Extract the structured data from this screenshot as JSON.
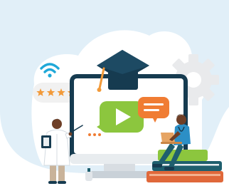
{
  "illustration": {
    "rating": {
      "value": 5,
      "max": 5
    },
    "colors": {
      "background": "#ffffff",
      "backdrop": "#e1eff8",
      "gear": "#e9eaec",
      "wifi": "#1fa8d8",
      "rating_pill": "#f1f1f1",
      "star": "#f29a3a",
      "monitor_frame": "#163b50",
      "monitor_screen": "#ffffff",
      "monitor_base": "#d8dde2",
      "play_bubble": "#8cc63e",
      "play_triangle": "#ffffff",
      "chat_bubble": "#f07c33",
      "cap": "#163b50",
      "tassel": "#f29a3a",
      "book_orange": "#e0683a",
      "book_green": "#8cc63e",
      "book_teal": "#1f5f6e",
      "book_navy": "#163b50",
      "doctor_coat": "#ffffff",
      "doctor_pants": "#c9b39a",
      "nurse_scrubs": "#2c8fc6",
      "skin_dark": "#6e3f27",
      "laptop": "#e6a463"
    }
  }
}
